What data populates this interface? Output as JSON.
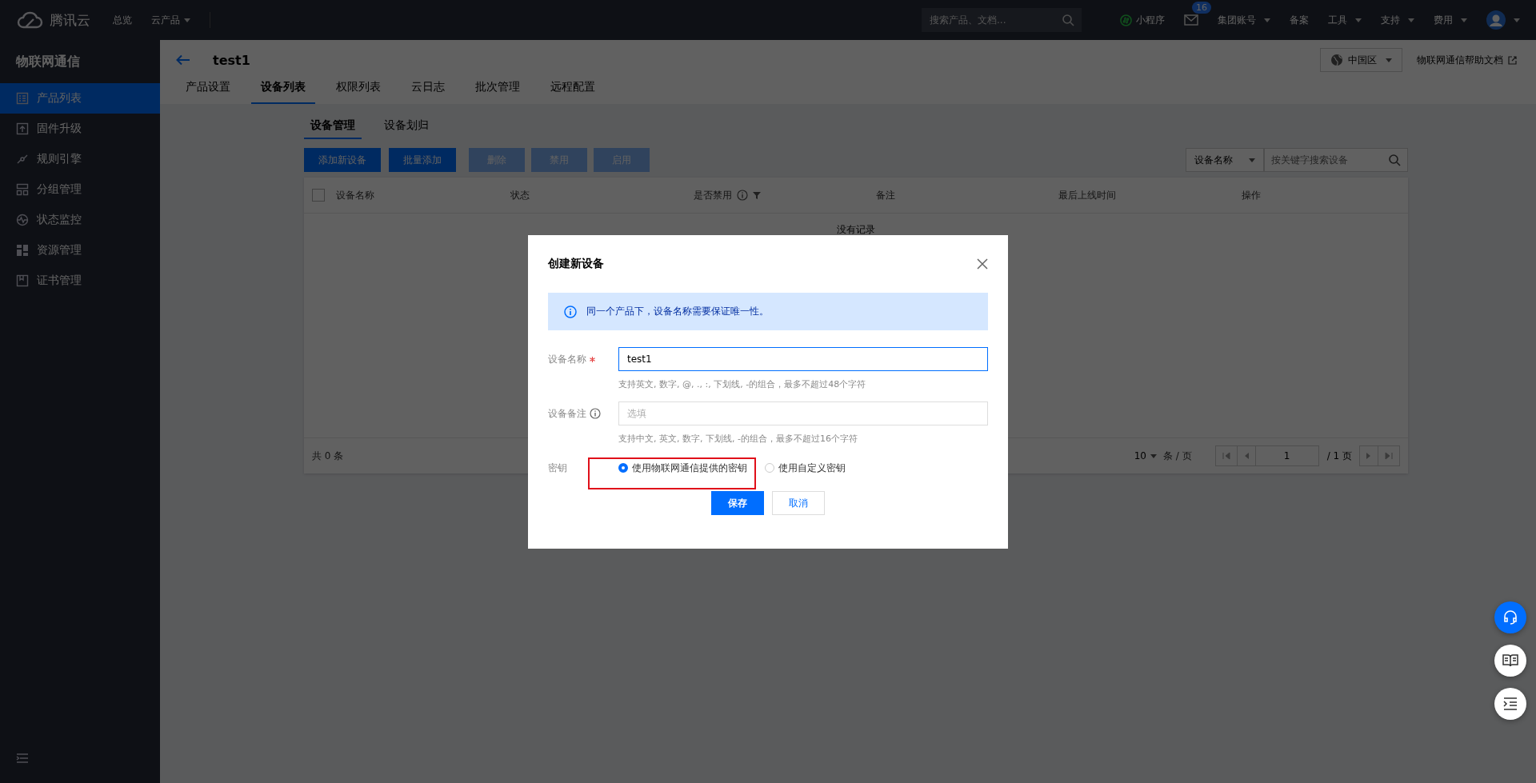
{
  "top_nav": {
    "logo": "腾讯云",
    "links": [
      {
        "label": "总览",
        "dropdown": false
      },
      {
        "label": "云产品",
        "dropdown": true
      }
    ],
    "search": {
      "placeholder": "搜索产品、文档..."
    },
    "items": [
      {
        "kind": "miniapp",
        "label": "小程序"
      },
      {
        "kind": "mail",
        "badge": "16"
      },
      {
        "kind": "menu",
        "label": "集团账号",
        "dropdown": true
      },
      {
        "kind": "menu",
        "label": "备案",
        "dropdown": false
      },
      {
        "kind": "menu",
        "label": "工具",
        "dropdown": true
      },
      {
        "kind": "menu",
        "label": "支持",
        "dropdown": true
      },
      {
        "kind": "menu",
        "label": "费用",
        "dropdown": true
      },
      {
        "kind": "avatar",
        "dropdown": true
      }
    ]
  },
  "sidebar": {
    "title": "物联网通信",
    "items": [
      {
        "label": "产品列表",
        "selected": true
      },
      {
        "label": "固件升级",
        "selected": false
      },
      {
        "label": "规则引擎",
        "selected": false
      },
      {
        "label": "分组管理",
        "selected": false
      },
      {
        "label": "状态监控",
        "selected": false
      },
      {
        "label": "资源管理",
        "selected": false
      },
      {
        "label": "证书管理",
        "selected": false
      }
    ]
  },
  "header": {
    "title": "test1",
    "region": "中国区",
    "help_link": "物联网通信帮助文档",
    "tabs": [
      {
        "label": "产品设置",
        "selected": false
      },
      {
        "label": "设备列表",
        "selected": true
      },
      {
        "label": "权限列表",
        "selected": false
      },
      {
        "label": "云日志",
        "selected": false
      },
      {
        "label": "批次管理",
        "selected": false
      },
      {
        "label": "远程配置",
        "selected": false
      }
    ]
  },
  "subtabs": [
    {
      "label": "设备管理",
      "selected": true
    },
    {
      "label": "设备划归",
      "selected": false
    }
  ],
  "toolbar": {
    "buttons": [
      {
        "label": "添加新设备",
        "disabled": false
      },
      {
        "label": "批量添加",
        "disabled": false
      },
      {
        "label": "删除",
        "disabled": true
      },
      {
        "label": "禁用",
        "disabled": true
      },
      {
        "label": "启用",
        "disabled": true
      }
    ],
    "filter_field": "设备名称",
    "search_placeholder": "按关键字搜索设备"
  },
  "table": {
    "select_all": {
      "checked": false
    },
    "columns": [
      {
        "label": "设备名称",
        "info": false,
        "filter": false
      },
      {
        "label": "状态",
        "info": false,
        "filter": false
      },
      {
        "label": "是否禁用",
        "info": true,
        "filter": true
      },
      {
        "label": "备注",
        "info": false,
        "filter": false
      },
      {
        "label": "最后上线时间",
        "info": false,
        "filter": false
      },
      {
        "label": "操作",
        "info": false,
        "filter": false
      }
    ],
    "empty_text": "没有记录",
    "pagination": {
      "total": "共 0 条",
      "page_size": "10",
      "per_page": "条 / 页",
      "page": "1",
      "pages": "/ 1 页"
    }
  },
  "dialog": {
    "title": "创建新设备",
    "notice": "同一个产品下，设备名称需要保证唯一性。",
    "fields": [
      {
        "label": "设备名称",
        "required": true,
        "info": false,
        "value": "test1",
        "focused": true,
        "hint": "支持英文, 数字, @, ., :, 下划线, -的组合，最多不超过48个字符"
      },
      {
        "label": "设备备注",
        "required": false,
        "info": true,
        "placeholder": "选填",
        "focused": false,
        "hint": "支持中文, 英文, 数字, 下划线, -的组合，最多不超过16个字符"
      }
    ],
    "key": {
      "label": "密钥",
      "options": [
        {
          "label": "使用物联网通信提供的密钥",
          "selected": true
        },
        {
          "label": "使用自定义密钥",
          "selected": false
        }
      ]
    },
    "buttons": [
      {
        "label": "保存",
        "primary": true
      },
      {
        "label": "取消",
        "primary": false
      }
    ],
    "annotation_box": true
  },
  "float_buttons": [
    {
      "kind": "support",
      "primary": true
    },
    {
      "kind": "docs",
      "primary": false
    },
    {
      "kind": "outline",
      "primary": false
    }
  ]
}
